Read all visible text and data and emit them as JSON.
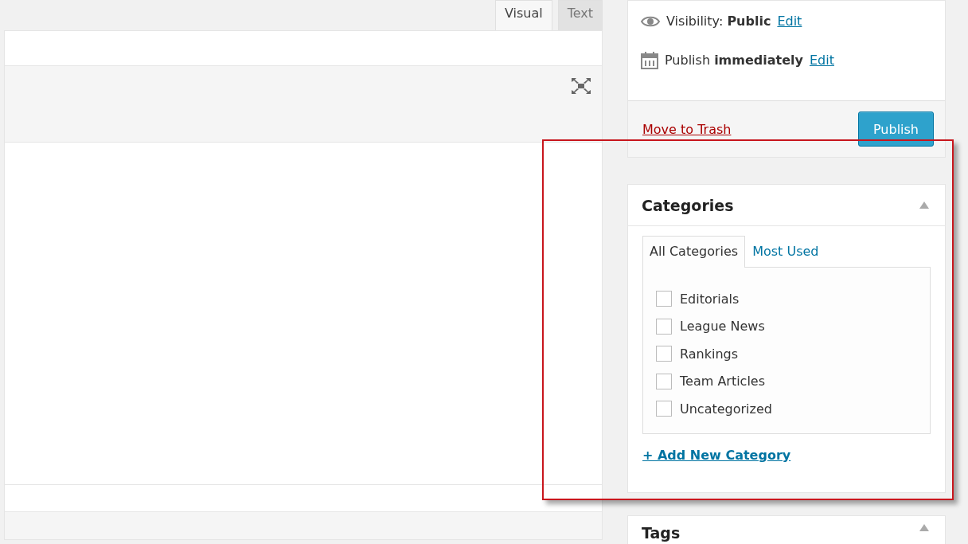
{
  "editor": {
    "tabs": [
      {
        "label": "Visual",
        "selected": true
      },
      {
        "label": "Text",
        "selected": false
      }
    ]
  },
  "publish": {
    "rows": [
      {
        "kind": "visibility",
        "label": "Visibility:",
        "value": "Public",
        "link": "Edit"
      },
      {
        "kind": "schedule",
        "label": "Publish",
        "value": "immediately",
        "link": "Edit"
      }
    ],
    "trash": "Move to Trash",
    "button": "Publish"
  },
  "categories": {
    "title": "Categories",
    "tabs": [
      {
        "label": "All Categories",
        "selected": true
      },
      {
        "label": "Most Used",
        "selected": false
      }
    ],
    "items": [
      {
        "label": "Editorials",
        "checked": false
      },
      {
        "label": "League News",
        "checked": false
      },
      {
        "label": "Rankings",
        "checked": false
      },
      {
        "label": "Team Articles",
        "checked": false
      },
      {
        "label": "Uncategorized",
        "checked": false
      }
    ],
    "add_link": "+ Add New Category"
  },
  "tags": {
    "title": "Tags"
  }
}
